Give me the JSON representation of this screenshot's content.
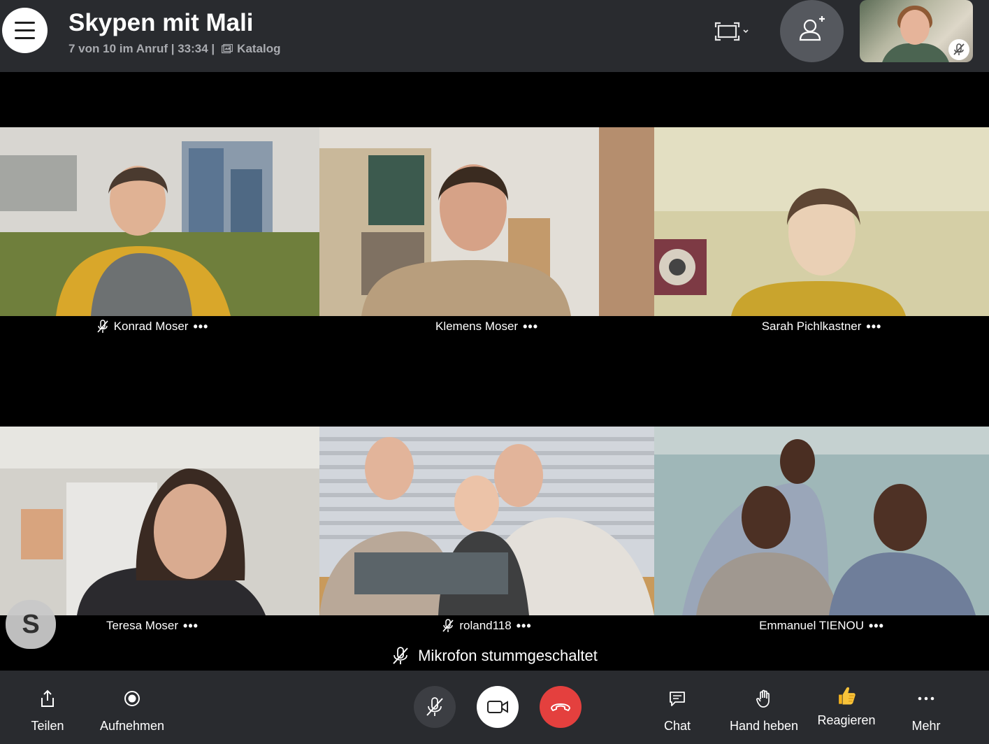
{
  "header": {
    "title": "Skypen mit Mali",
    "subtitle_status": "7 von 10 im Anruf | 33:34 |",
    "subtitle_view": "Katalog",
    "menu_icon": "hamburger-menu-icon",
    "layout_icon": "fullscreen-icon",
    "add_people_icon": "add-person-icon",
    "self_mute_icon": "mic-off-icon"
  },
  "participants": [
    {
      "name": "Konrad Moser",
      "muted": true
    },
    {
      "name": "Klemens Moser",
      "muted": false
    },
    {
      "name": "Sarah Pichlkastner",
      "muted": false
    },
    {
      "name": "Teresa Moser",
      "muted": false
    },
    {
      "name": "roland118",
      "muted": true
    },
    {
      "name": "Emmanuel TIENOU",
      "muted": false
    }
  ],
  "more_dots": "•••",
  "status": {
    "text": "Mikrofon stummgeschaltet",
    "icon": "mic-off-icon"
  },
  "logo": {
    "text": "S",
    "icon": "skype-logo-icon"
  },
  "toolbar": {
    "share_label": "Teilen",
    "record_label": "Aufnehmen",
    "chat_label": "Chat",
    "raise_hand_label": "Hand heben",
    "react_label": "Reagieren",
    "more_label": "Mehr",
    "mute_icon": "mic-off-icon",
    "video_icon": "video-camera-icon",
    "hangup_icon": "phone-hangup-icon"
  },
  "colors": {
    "bar": "#292b2f",
    "hangup": "#e4403e",
    "add_people": "#55585e",
    "muted_button": "#3c3e43"
  }
}
